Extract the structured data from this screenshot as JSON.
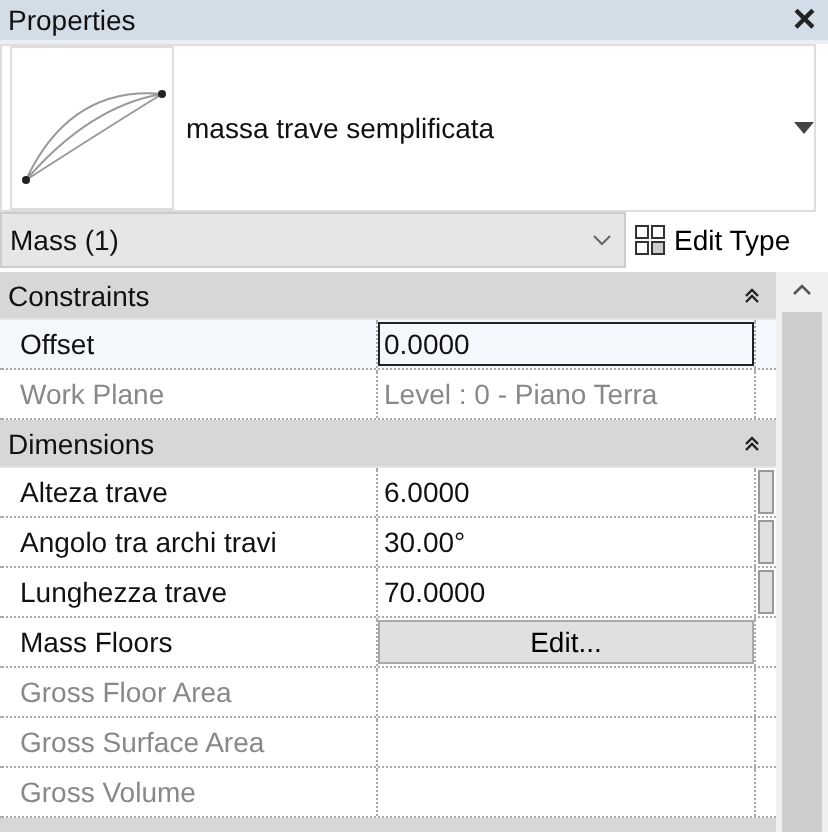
{
  "window": {
    "title": "Properties",
    "close": "×"
  },
  "type_selector": {
    "name": "massa trave semplificata"
  },
  "filter": {
    "value": "Mass (1)",
    "edit_type": "Edit Type"
  },
  "sections": [
    {
      "title": "Constraints",
      "expanded": true,
      "rows": [
        {
          "label": "Offset",
          "kind": "text",
          "value": "0.0000",
          "disabled": false,
          "selected": true
        },
        {
          "label": "Work Plane",
          "kind": "text",
          "value": "Level : 0 - Piano Terra",
          "disabled": true,
          "selected": false
        }
      ]
    },
    {
      "title": "Dimensions",
      "expanded": true,
      "rows": [
        {
          "label": "Alteza trave",
          "kind": "text",
          "value": "6.0000",
          "disabled": false,
          "selected": false,
          "side_button": true
        },
        {
          "label": "Angolo tra archi travi",
          "kind": "text",
          "value": "30.00°",
          "disabled": false,
          "selected": false,
          "side_button": true
        },
        {
          "label": "Lunghezza trave",
          "kind": "text",
          "value": "70.0000",
          "disabled": false,
          "selected": false,
          "side_button": true
        },
        {
          "label": "Mass Floors",
          "kind": "button",
          "value": "Edit...",
          "disabled": false,
          "selected": false
        },
        {
          "label": "Gross Floor Area",
          "kind": "text",
          "disabled": true,
          "selected": false
        },
        {
          "label": "Gross Surface Area",
          "kind": "text",
          "disabled": true,
          "selected": false
        },
        {
          "label": "Gross Volume",
          "kind": "text",
          "disabled": true,
          "selected": false
        }
      ]
    }
  ]
}
